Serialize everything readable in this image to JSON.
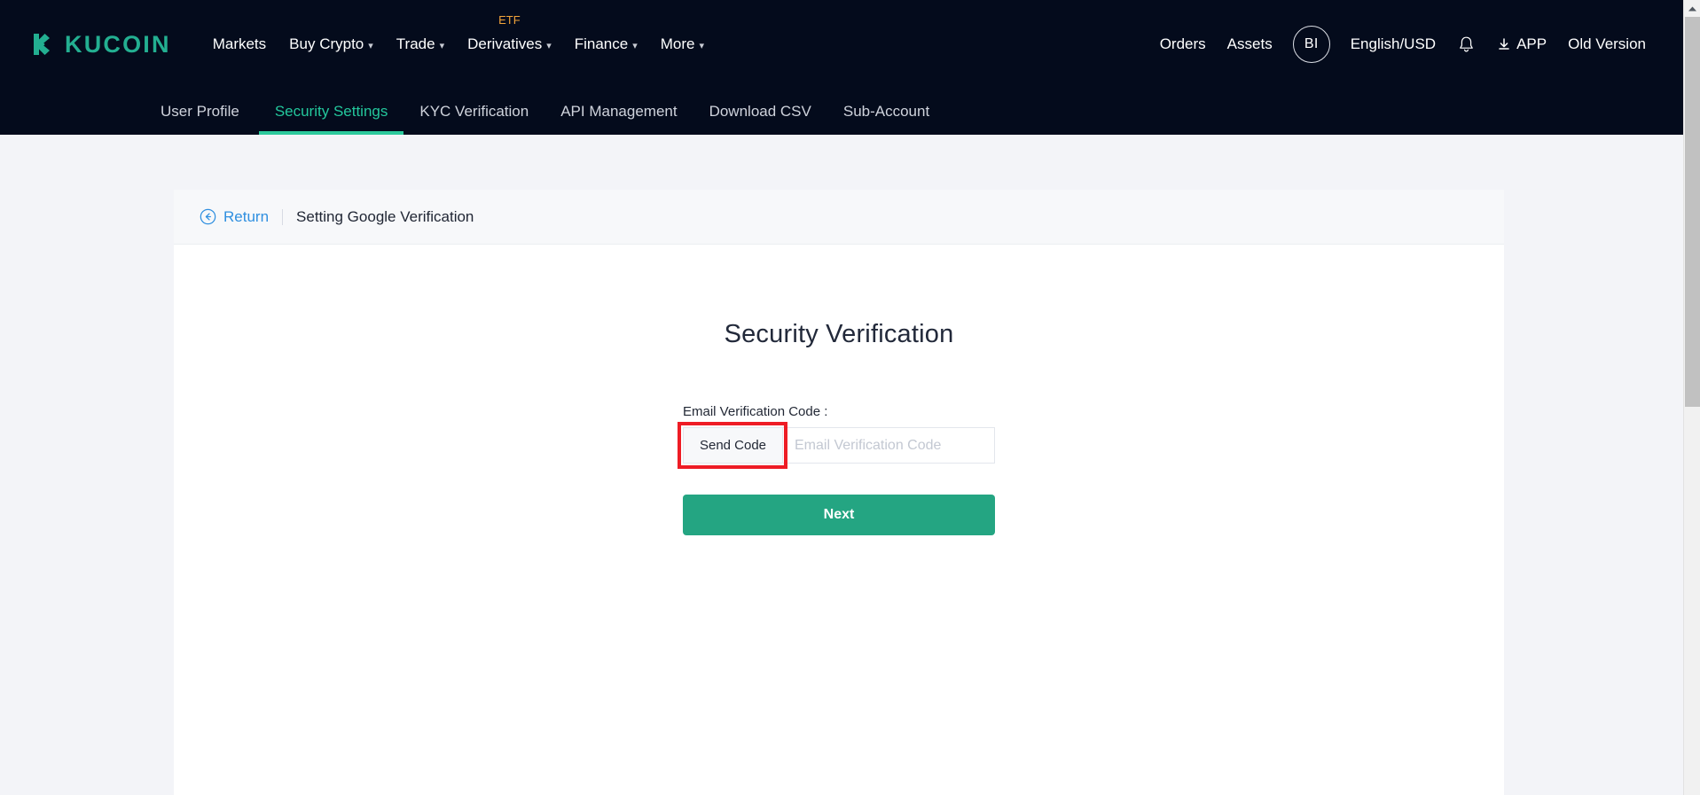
{
  "brand": {
    "logo_text": "KUCOIN",
    "logo_icon": "kucoin-logo-icon",
    "accent_color": "#23af91"
  },
  "header": {
    "nav": [
      {
        "label": "Markets",
        "has_caret": false,
        "badge": null
      },
      {
        "label": "Buy Crypto",
        "has_caret": true,
        "badge": null
      },
      {
        "label": "Trade",
        "has_caret": true,
        "badge": null
      },
      {
        "label": "Derivatives",
        "has_caret": true,
        "badge": "ETF"
      },
      {
        "label": "Finance",
        "has_caret": true,
        "badge": null
      },
      {
        "label": "More",
        "has_caret": true,
        "badge": null
      }
    ],
    "right": {
      "orders": "Orders",
      "assets": "Assets",
      "avatar_initials": "BI",
      "language": "English/USD",
      "notification_icon": "bell-icon",
      "app_label": "APP",
      "app_icon": "download-icon",
      "old_version": "Old Version"
    },
    "etf_badge_color": "#f0a33a",
    "background_color": "#040b1c"
  },
  "subnav": {
    "items": [
      {
        "label": "User Profile",
        "active": false
      },
      {
        "label": "Security Settings",
        "active": true
      },
      {
        "label": "KYC Verification",
        "active": false
      },
      {
        "label": "API Management",
        "active": false
      },
      {
        "label": "Download CSV",
        "active": false
      },
      {
        "label": "Sub-Account",
        "active": false
      }
    ],
    "active_color": "#23c79c"
  },
  "breadcrumb": {
    "return_label": "Return",
    "return_icon": "circle-arrow-left-icon",
    "current": "Setting Google Verification",
    "return_color": "#2f8fe0"
  },
  "main": {
    "title": "Security Verification",
    "email_code": {
      "label": "Email Verification Code :",
      "send_code_label": "Send Code",
      "input_value": "",
      "input_placeholder": "Email Verification Code"
    },
    "next_label": "Next",
    "next_color": "#24a582",
    "highlight_color": "#ee1c25",
    "highlight_target": "send-code-button"
  },
  "scrollbar": {
    "up_arrow_icon": "scroll-up-arrow-icon"
  }
}
